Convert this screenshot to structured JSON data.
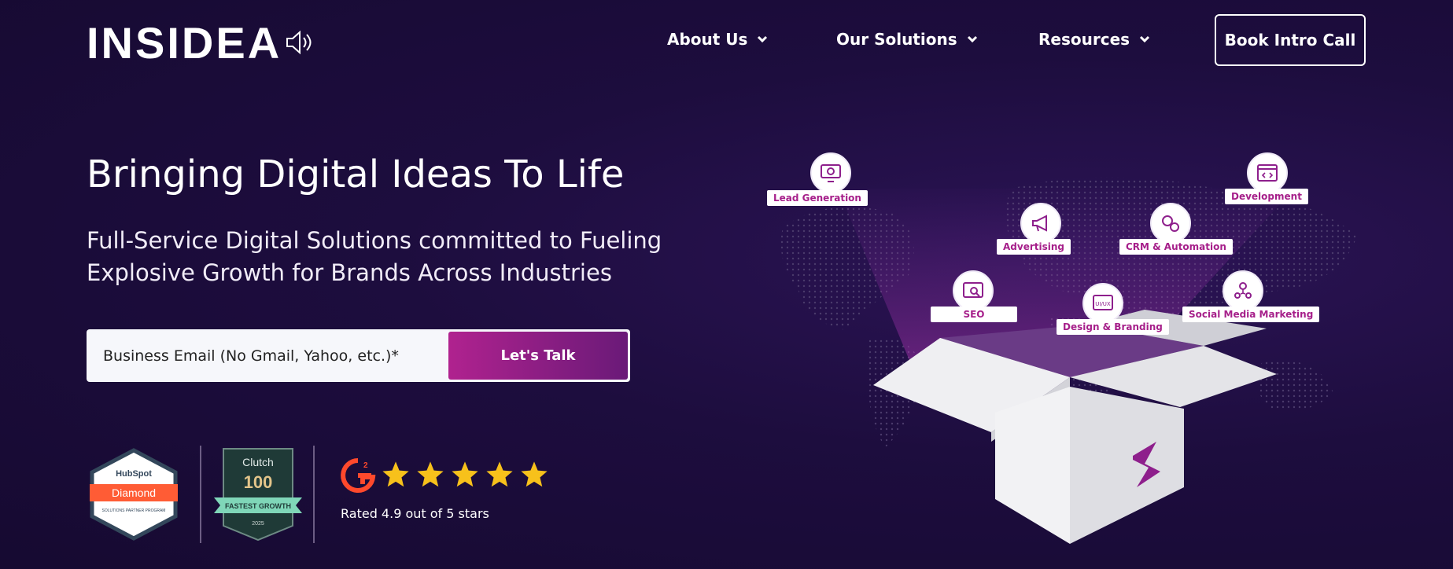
{
  "header": {
    "logo": "INSIDEA",
    "nav": [
      {
        "label": "About Us"
      },
      {
        "label": "Our Solutions"
      },
      {
        "label": "Resources"
      }
    ],
    "cta_label": "Book Intro Call"
  },
  "hero": {
    "title": "Bringing Digital Ideas To Life",
    "subtitle": "Full-Service Digital Solutions committed to Fueling Explosive Growth for Brands Across Industries",
    "email_placeholder": "Business Email (No Gmail, Yahoo, etc.)*",
    "submit_label": "Let's Talk"
  },
  "badges": {
    "hubspot": {
      "brand": "HubSpot",
      "tier": "Diamond",
      "program": "SOLUTIONS PARTNER PROGRAM"
    },
    "clutch": {
      "brand": "Clutch",
      "rank": "100",
      "ribbon": "FASTEST GROWTH",
      "year": "2025"
    },
    "g2": {
      "rating": 4.9,
      "max": 5,
      "text": "Rated 4.9 out of 5 stars"
    }
  },
  "services": [
    {
      "label": "Lead Generation",
      "icon": "monitor-gear-icon"
    },
    {
      "label": "Development",
      "icon": "browser-code-icon"
    },
    {
      "label": "Advertising",
      "icon": "megaphone-icon"
    },
    {
      "label": "CRM & Automation",
      "icon": "gears-icon"
    },
    {
      "label": "SEO",
      "icon": "seo-chart-icon"
    },
    {
      "label": "Design & Branding",
      "icon": "ui-ux-icon"
    },
    {
      "label": "Social Media Marketing",
      "icon": "social-network-icon"
    }
  ],
  "colors": {
    "background": "#1d0d3e",
    "accent_start": "#b0228f",
    "accent_end": "#6a1a78",
    "tag_text": "#a61f8a",
    "star": "#f7c11b",
    "hubspot_orange": "#ff5c35",
    "clutch_green": "#7fd6b8"
  }
}
